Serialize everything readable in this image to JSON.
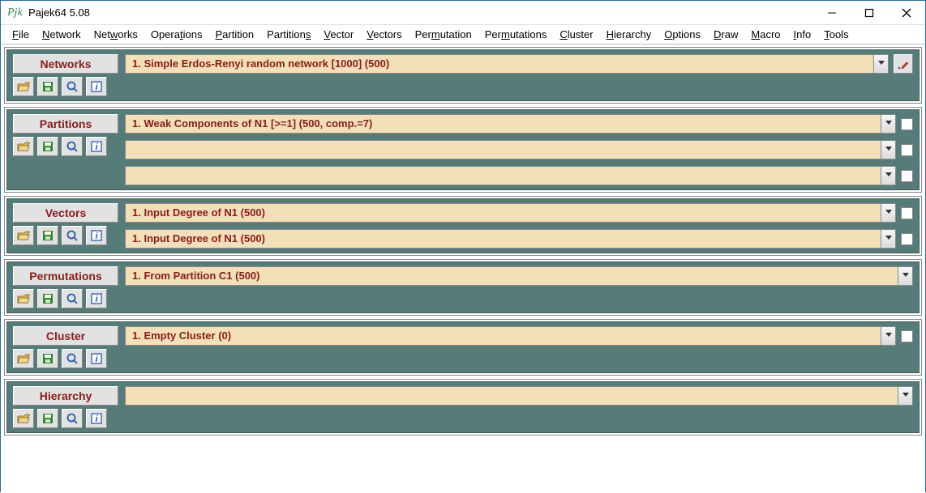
{
  "window": {
    "title": "Pajek64 5.08"
  },
  "menu": [
    "File",
    "Network",
    "Networks",
    "Operations",
    "Partition",
    "Partitions",
    "Vector",
    "Vectors",
    "Permutation",
    "Permutations",
    "Cluster",
    "Hierarchy",
    "Options",
    "Draw",
    "Macro",
    "Info",
    "Tools"
  ],
  "menu_ul": [
    0,
    0,
    3,
    5,
    0,
    9,
    0,
    0,
    3,
    3,
    0,
    0,
    0,
    0,
    0,
    0,
    0
  ],
  "panels": {
    "networks": {
      "title": "Networks",
      "rows": [
        {
          "text": "1. Simple Erdos-Renyi random network [1000] (500)",
          "edit": true
        }
      ]
    },
    "partitions": {
      "title": "Partitions",
      "rows": [
        {
          "text": "1. Weak Components of N1 [>=1] (500, comp.=7)",
          "check": true
        },
        {
          "text": "",
          "check": true
        },
        {
          "text": "",
          "check": true
        }
      ]
    },
    "vectors": {
      "title": "Vectors",
      "rows": [
        {
          "text": "1. Input Degree of N1 (500)",
          "check": true
        },
        {
          "text": "1. Input Degree of N1 (500)",
          "check": true
        }
      ]
    },
    "permutations": {
      "title": "Permutations",
      "rows": [
        {
          "text": "1. From Partition C1 (500)"
        }
      ]
    },
    "cluster": {
      "title": "Cluster",
      "rows": [
        {
          "text": "1. Empty Cluster (0)",
          "check": true
        }
      ]
    },
    "hierarchy": {
      "title": "Hierarchy",
      "rows": [
        {
          "text": ""
        }
      ]
    }
  },
  "icons": {
    "open": "folder-open-icon",
    "save": "disk-save-icon",
    "search": "magnifier-icon",
    "info": "info-icon",
    "pencil": "pencil-icon",
    "dropdown": "chevron-down-icon"
  }
}
